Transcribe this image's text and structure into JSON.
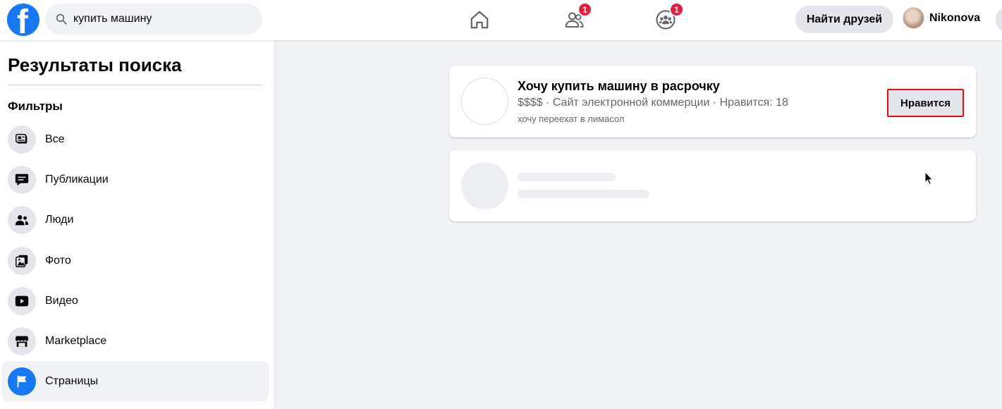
{
  "topbar": {
    "search": {
      "value": "купить машину",
      "placeholder": ""
    },
    "friends_badge": "1",
    "groups_badge": "1",
    "find_friends_label": "Найти друзей",
    "profile_name": "Nikonova"
  },
  "sidebar": {
    "title": "Результаты поиска",
    "filters_heading": "Фильтры",
    "items": [
      {
        "label": "Все",
        "icon": "posts-card-icon"
      },
      {
        "label": "Публикации",
        "icon": "speech-bubble-icon"
      },
      {
        "label": "Люди",
        "icon": "people-icon"
      },
      {
        "label": "Фото",
        "icon": "photo-icon"
      },
      {
        "label": "Видео",
        "icon": "video-play-icon"
      },
      {
        "label": "Marketplace",
        "icon": "shop-icon"
      },
      {
        "label": "Страницы",
        "icon": "flag-icon",
        "selected": true
      }
    ]
  },
  "results": [
    {
      "title": "Хочу купить машину в расрочку",
      "meta": "$$$$ · Сайт электронной коммерции · Нравится: 18",
      "description": "хочу переехат в лимасол",
      "action_label": "Нравится"
    }
  ],
  "colors": {
    "brand": "#1877f2",
    "badge": "#e41e3f",
    "highlight_outline": "#e01010",
    "page_background": "#f0f2f5"
  }
}
